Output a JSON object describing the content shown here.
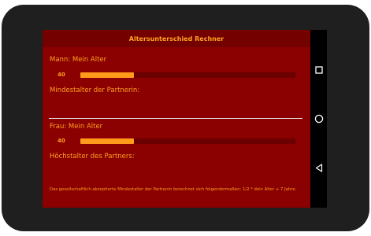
{
  "app": {
    "title": "Altersunterschied Rechner"
  },
  "male": {
    "label": "Mann: Mein Alter",
    "age": "40",
    "slider_fraction": 0.25,
    "result_label": "Mindestalter der Partnerin:"
  },
  "female": {
    "label": "Frau: Mein Alter",
    "age": "40",
    "slider_fraction": 0.25,
    "result_label": "Höchstalter des Partners:"
  },
  "footnote": "Das gesellschaftlich akzeptierte Mindestalter der Partnerin berechnet sich folgendermaßen: 1/2 * dein Alter + 7 Jahre.",
  "colors": {
    "background": "#8b0000",
    "titlebar": "#750000",
    "accent": "#ffa21f",
    "track": "#6a0000"
  },
  "navbar": {
    "icons": [
      "recent-apps-icon",
      "home-icon",
      "back-icon"
    ]
  }
}
